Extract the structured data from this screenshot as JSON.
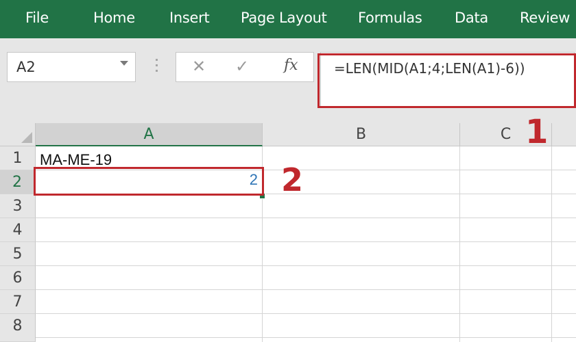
{
  "ribbon": {
    "tabs": [
      {
        "label": "File"
      },
      {
        "label": "Home"
      },
      {
        "label": "Insert"
      },
      {
        "label": "Page Layout"
      },
      {
        "label": "Formulas"
      },
      {
        "label": "Data"
      },
      {
        "label": "Review"
      }
    ],
    "color": "#217346"
  },
  "formula_bar": {
    "name_box": "A2",
    "cancel_icon": "close-icon",
    "enter_icon": "check-icon",
    "fx_label": "fx",
    "formula": "=LEN(MID(A1;4;LEN(A1)-6))"
  },
  "grid": {
    "columns": [
      "A",
      "B",
      "C"
    ],
    "active_column": "A",
    "rows": [
      "1",
      "2",
      "3",
      "4",
      "5",
      "6",
      "7",
      "8"
    ],
    "active_row": "2",
    "cells": {
      "A1": "MA-ME-19",
      "A2": "2"
    }
  },
  "annotations": {
    "marker_1": "1",
    "marker_2": "2",
    "color": "#c0282d"
  }
}
